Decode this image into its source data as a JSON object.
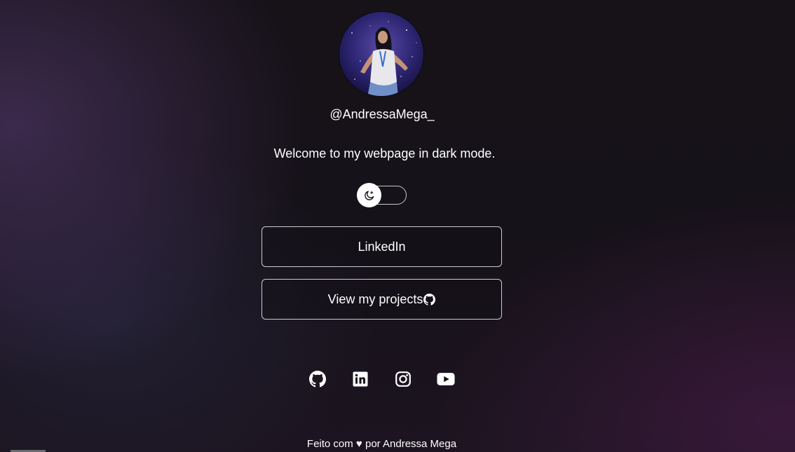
{
  "profile": {
    "handle": "@AndressaMega_",
    "welcome": "Welcome to my webpage in dark mode."
  },
  "theme_toggle": {
    "icon": "moon-stars-icon",
    "state": "dark"
  },
  "links": [
    {
      "label": "LinkedIn"
    },
    {
      "label": "View my projects",
      "icon": "github-icon"
    }
  ],
  "socials": [
    {
      "icon": "github-icon"
    },
    {
      "icon": "linkedin-icon"
    },
    {
      "icon": "instagram-icon"
    },
    {
      "icon": "youtube-icon"
    }
  ],
  "footer": {
    "text": "Feito com ♥ por Andressa Mega"
  },
  "colors": {
    "text": "#ffffff",
    "background": "#161218",
    "border": "#cfcbd2"
  }
}
